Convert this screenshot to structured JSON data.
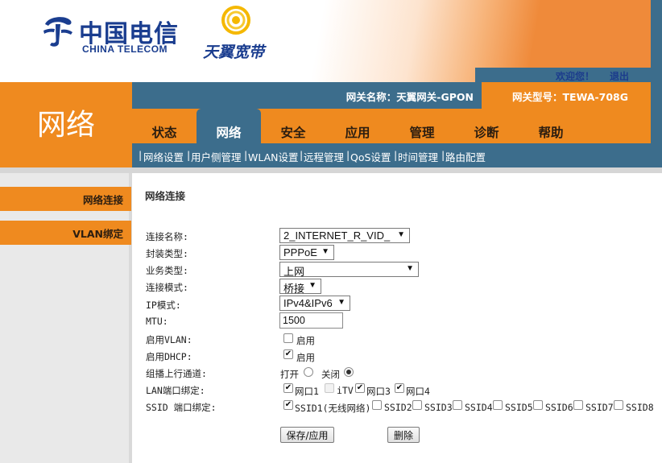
{
  "header": {
    "brand_cn": "中国电信",
    "brand_en": "CHINA TELECOM",
    "broadband_logo": "天翼宽带",
    "welcome": "欢迎您！",
    "logout": "退出",
    "gateway_name": "网关名称：天翼网关-GPON",
    "gateway_model": "网关型号：TEWA-708G"
  },
  "section_title": "网络",
  "tabs": [
    "状态",
    "网络",
    "安全",
    "应用",
    "管理",
    "诊断",
    "帮助"
  ],
  "active_tab": "网络",
  "subnav": [
    "网络设置",
    "用户侧管理",
    "WLAN设置",
    "远程管理",
    "QoS设置",
    "时间管理",
    "路由配置"
  ],
  "subnav_sep": "|",
  "sidebar": [
    "网络连接",
    "VLAN绑定"
  ],
  "form": {
    "title": "网络连接",
    "labels": {
      "conn_name": "连接名称:",
      "encap": "封装类型:",
      "service": "业务类型:",
      "mode": "连接模式:",
      "ip_mode": "IP模式:",
      "mtu": "MTU:",
      "vlan": "启用VLAN:",
      "dhcp": "启用DHCP:",
      "multicast": "组播上行通道:",
      "lan_bind": "LAN端口绑定:",
      "ssid_bind": "SSID 端口绑定:"
    },
    "values": {
      "conn_name": "2_INTERNET_R_VID_",
      "encap": "PPPoE",
      "service": "上网",
      "mode": "桥接",
      "ip_mode": "IPv4&IPv6",
      "mtu": "1500",
      "enable_label": "启用",
      "vlan_checked": false,
      "dhcp_checked": true
    },
    "multicast": {
      "open": "打开",
      "close": "关闭",
      "selected": "关闭"
    },
    "lan_ports": [
      {
        "name": "网口1",
        "checked": true,
        "disabled": false
      },
      {
        "name": "iTV",
        "checked": false,
        "disabled": true
      },
      {
        "name": "网口3",
        "checked": true,
        "disabled": false
      },
      {
        "name": "网口4",
        "checked": true,
        "disabled": false
      }
    ],
    "ssids": [
      {
        "name": "SSID1(无线网络)",
        "checked": true
      },
      {
        "name": "SSID2",
        "checked": false
      },
      {
        "name": "SSID3",
        "checked": false
      },
      {
        "name": "SSID4",
        "checked": false
      },
      {
        "name": "SSID5",
        "checked": false
      },
      {
        "name": "SSID6",
        "checked": false
      },
      {
        "name": "SSID7",
        "checked": false
      },
      {
        "name": "SSID8",
        "checked": false
      }
    ],
    "buttons": {
      "save": "保存/应用",
      "delete": "删除"
    },
    "check_mark": "✔",
    "select_arrow": "▼"
  },
  "colors": {
    "orange": "#ef8a1f",
    "steel_blue": "#3c6d8c",
    "brand_blue": "#1a3d8f",
    "ty_yellow": "#f5b800"
  }
}
